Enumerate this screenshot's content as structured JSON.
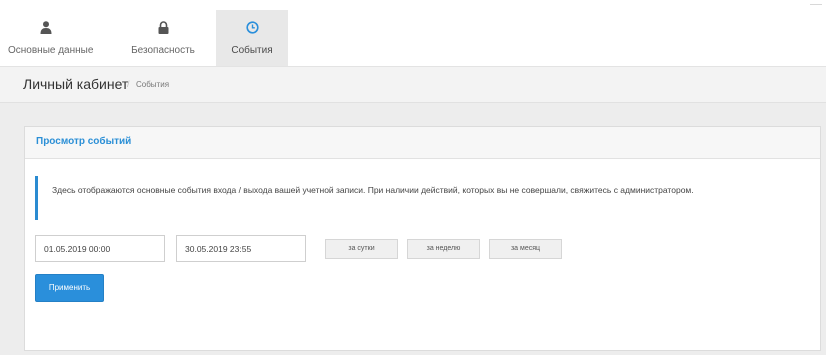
{
  "tabs": [
    {
      "label": "Основные данные",
      "icon": "user-icon",
      "active": false
    },
    {
      "label": "Безопасность",
      "icon": "lock-icon",
      "active": false
    },
    {
      "label": "События",
      "icon": "clock-icon",
      "active": true
    }
  ],
  "breadcrumb": {
    "title": "Личный кабинет",
    "separator": "/",
    "current": "События"
  },
  "panel": {
    "title": "Просмотр событий",
    "info_text": "Здесь отображаются основные события входа / выхода вашей учетной записи. При наличии действий, которых вы не совершали, свяжитесь с администратором.",
    "date_from": "01.05.2019 00:00",
    "date_to": "30.05.2019 23:55",
    "range_buttons": [
      "за сутки",
      "за неделю",
      "за месяц"
    ],
    "apply_label": "Применить"
  },
  "colors": {
    "accent": "#2a8fdb",
    "title_blue": "#2b8fd6",
    "background": "#ededed"
  }
}
